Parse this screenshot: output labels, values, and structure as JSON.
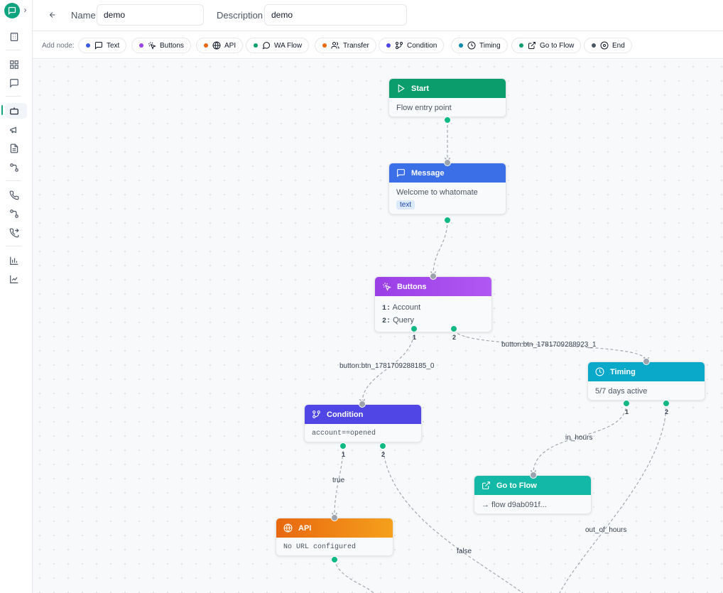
{
  "header": {
    "name_label": "Name",
    "name_value": "demo",
    "description_label": "Description",
    "description_value": "demo"
  },
  "toolbar": {
    "add_node_label": "Add node:",
    "chips": [
      {
        "label": "Text",
        "dot": "#3b5bdb",
        "icon": "message-square-icon"
      },
      {
        "label": "Buttons",
        "dot": "#9b45e6",
        "icon": "pointer-click-icon"
      },
      {
        "label": "API",
        "dot": "#e8690f",
        "icon": "globe-icon"
      },
      {
        "label": "WA Flow",
        "dot": "#0c9d6c",
        "icon": "message-circle-icon"
      },
      {
        "label": "Transfer",
        "dot": "#e8690f",
        "icon": "users-icon"
      },
      {
        "label": "Condition",
        "dot": "#4f46e5",
        "icon": "git-branch-icon"
      },
      {
        "label": "Timing",
        "dot": "#0c89a8",
        "icon": "clock-icon"
      },
      {
        "label": "Go to Flow",
        "dot": "#0c9d6c",
        "icon": "external-link-icon"
      },
      {
        "label": "End",
        "dot": "#4b5563",
        "icon": "stop-circle-icon"
      }
    ]
  },
  "nodes": {
    "start": {
      "title": "Start",
      "body": "Flow entry point",
      "color": "#0c9d6c"
    },
    "message": {
      "title": "Message",
      "body": "Welcome to whatomate",
      "tag": "text",
      "color": "#3b6fe8"
    },
    "buttons": {
      "title": "Buttons",
      "items": [
        {
          "num": "1:",
          "label": "Account"
        },
        {
          "num": "2:",
          "label": "Query"
        }
      ],
      "color": "#a84cef"
    },
    "timing": {
      "title": "Timing",
      "body": "5/7 days active",
      "color": "#0aa8c9"
    },
    "condition": {
      "title": "Condition",
      "body": "account==opened",
      "color": "#4f46e5"
    },
    "goto": {
      "title": "Go to Flow",
      "body": "→ flow d9ab091f...",
      "color": "#14b8a6"
    },
    "api": {
      "title": "API",
      "body": "No URL configured",
      "color": "#f08a18"
    }
  },
  "handle_labels": {
    "one": "1",
    "two": "2"
  },
  "edges": {
    "btn1": "button:btn_1781709288185_0",
    "btn2": "button:btn_1781709288923_1",
    "in_hours": "in_hours",
    "out_of_hours": "out_of_hours",
    "true": "true",
    "false": "false"
  }
}
